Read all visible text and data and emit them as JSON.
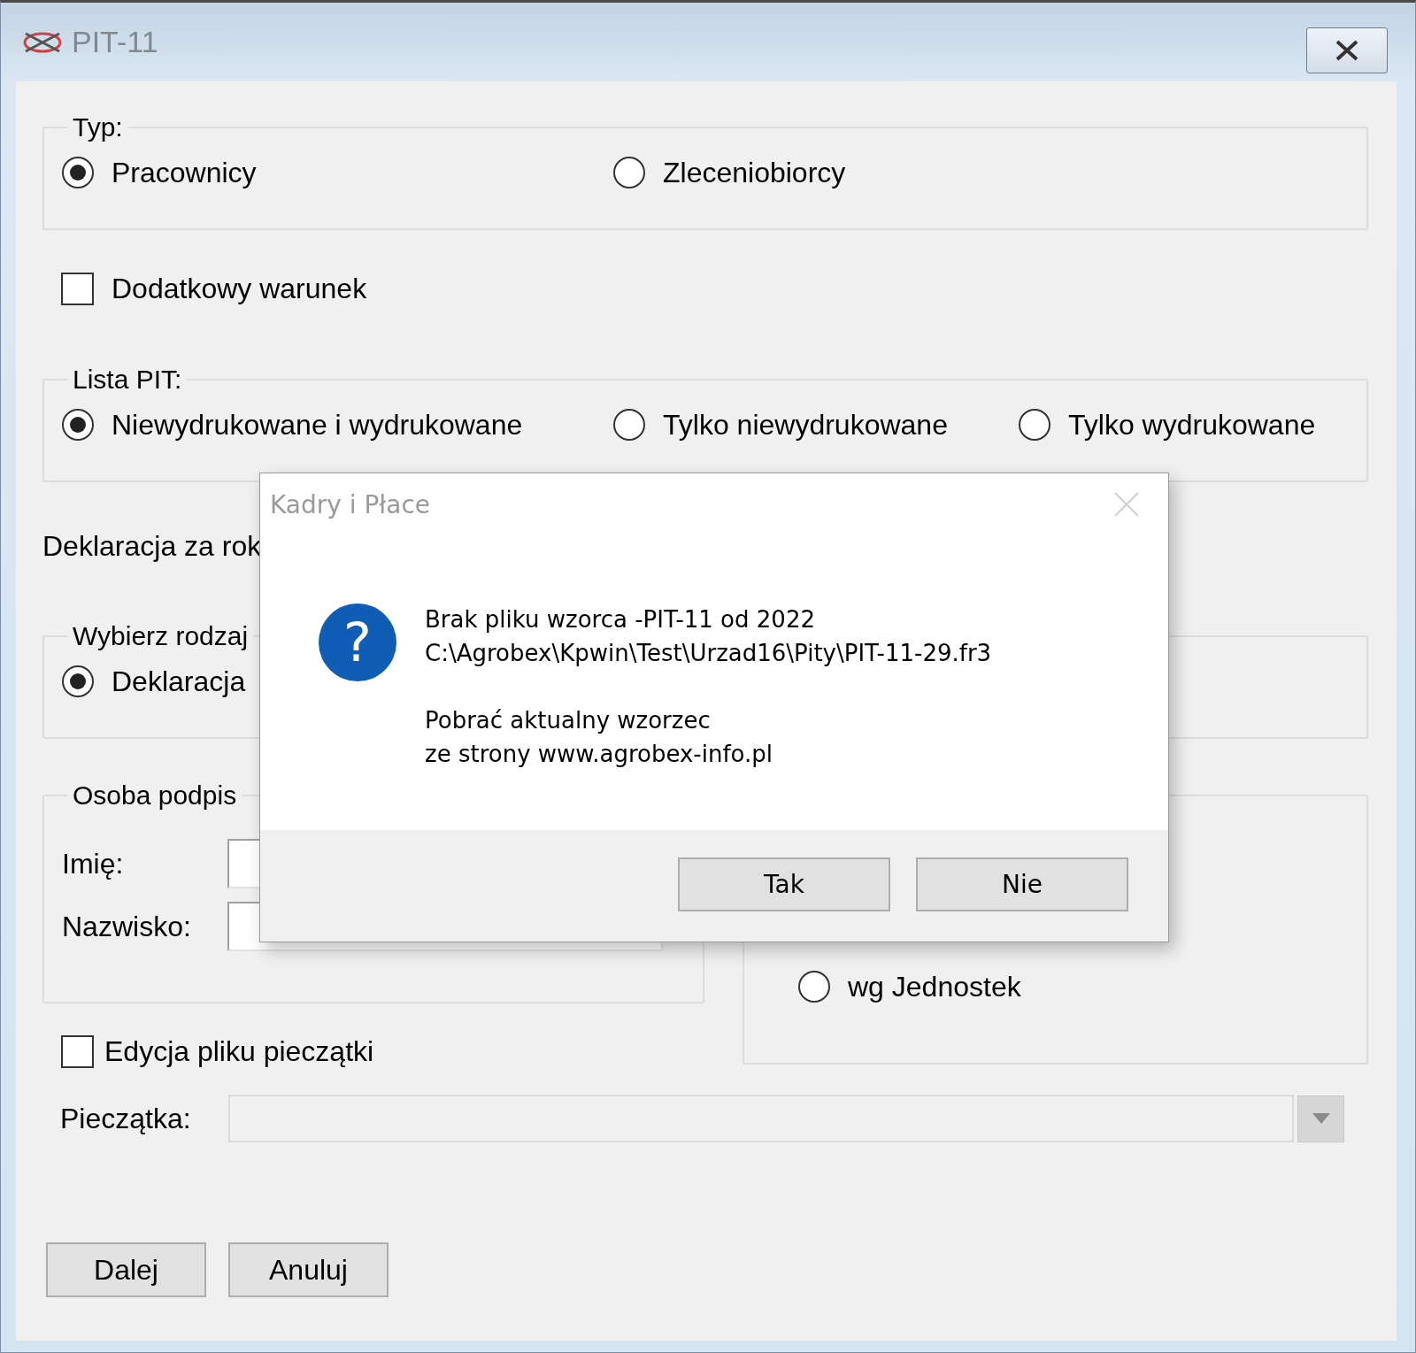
{
  "window": {
    "title": "PIT-11"
  },
  "typ": {
    "label": "Typ:",
    "options": [
      {
        "label": "Pracownicy",
        "selected": true
      },
      {
        "label": "Zleceniobiorcy",
        "selected": false
      }
    ]
  },
  "dodatkowy_warunek": {
    "label": "Dodatkowy warunek",
    "checked": false
  },
  "lista_pit": {
    "label": "Lista PIT:",
    "options": [
      {
        "label": "Niewydrukowane i wydrukowane",
        "selected": true
      },
      {
        "label": "Tylko niewydrukowane",
        "selected": false
      },
      {
        "label": "Tylko wydrukowane",
        "selected": false
      }
    ]
  },
  "deklaracja_za_rok": {
    "label": "Deklaracja za rok"
  },
  "wybierz_rodzaj": {
    "label": "Wybierz rodzaj",
    "options": [
      {
        "label": "Deklaracja",
        "selected": true
      }
    ]
  },
  "osoba_podpisu": {
    "label": "Osoba podpis",
    "fields": [
      {
        "label": "Imię:"
      },
      {
        "label": "Nazwisko:"
      }
    ]
  },
  "group_2": {
    "options": [
      {
        "label": "wg Jednostek",
        "selected": false
      }
    ]
  },
  "edycja_pliku": {
    "label": "Edycja pliku pieczątki",
    "checked": false
  },
  "pieczatka": {
    "label": "Pieczątka:",
    "disabled": true
  },
  "buttons": [
    "Dalej",
    "Anuluj"
  ],
  "dialog": {
    "title": "Kadry i Płace",
    "icon_glyph": "?",
    "paragraphs": [
      [
        "Brak pliku wzorca -PIT-11 od 2022",
        "C:\\Agrobex\\Kpwin\\Test\\Urzad16\\Pity\\PIT-11-29.fr3"
      ],
      [
        "Pobrać aktualny wzorzec",
        "ze strony www.agrobex-info.pl"
      ]
    ],
    "buttons": [
      "Tak",
      "Nie"
    ]
  }
}
